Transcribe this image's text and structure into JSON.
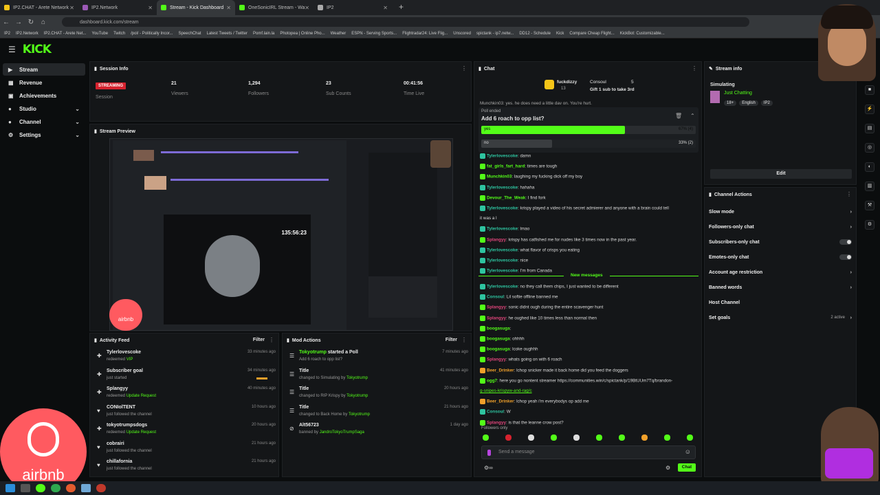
{
  "browser": {
    "tabs": [
      {
        "title": "IP2.CHAT - Arete Network",
        "color": "#f5c518"
      },
      {
        "title": "IP2.Network",
        "color": "#9b59b6"
      },
      {
        "title": "Stream - Kick Dashboard",
        "color": "#53fc18"
      },
      {
        "title": "OneSonicIRL Stream - Wa",
        "color": "#53fc18"
      },
      {
        "title": "IP2",
        "color": "#aaaaaa"
      }
    ],
    "url": "dashboard.kick.com/stream",
    "bookmarks": [
      "IP2",
      "IP2.Network",
      "IP2.CHAT - Arete Net...",
      "YouTube",
      "Twitch",
      "/pol/ - Politically Incor...",
      "SpeechChat",
      "Latest Tweets / Twitter",
      "Pomf.lain.la",
      "Photopea | Online Pho...",
      "Weather",
      "ESPN - Serving Sports...",
      "Flightradar24: Live Flig...",
      "Unscored",
      "spictank - ip7.netw...",
      "DD12 - Schedule",
      "Kick",
      "Compare Cheap Flight...",
      "KickBot: Customizable..."
    ]
  },
  "app": {
    "logo": "KICK",
    "accent": "#53fc18"
  },
  "sidebar": {
    "items": [
      {
        "label": "Stream",
        "icon": "play-icon"
      },
      {
        "label": "Revenue",
        "icon": "revenue-icon"
      },
      {
        "label": "Achievements",
        "icon": "trophy-icon"
      },
      {
        "label": "Studio",
        "icon": "studio-icon"
      },
      {
        "label": "Channel",
        "icon": "channel-icon"
      },
      {
        "label": "Settings",
        "icon": "gear-icon"
      }
    ]
  },
  "session": {
    "title": "Session Info",
    "status": "STREAMING",
    "session_label": "Session",
    "viewers": "21",
    "viewers_label": "Viewers",
    "followers": "1,294",
    "followers_label": "Followers",
    "subs": "23",
    "subs_label": "Sub Counts",
    "time": "00:41:56",
    "time_label": "Time Live"
  },
  "preview": {
    "title": "Stream Preview",
    "timer": "135:56:23",
    "sponsor": "airbnb"
  },
  "activity": {
    "title": "Activity Feed",
    "filter": "Filter",
    "rows": [
      {
        "icon": "sub-icon",
        "name": "Tylerlovescoke",
        "sub": "redeemed",
        "hl": "VIP",
        "time": "33 minutes ago"
      },
      {
        "icon": "goal-icon",
        "name": "Subscriber goal",
        "sub": "just started",
        "hl": "",
        "time": "34 minutes ago"
      },
      {
        "icon": "sub-icon",
        "name": "Splangyy",
        "sub": "redeemed",
        "hl": "Update Request",
        "time": "40 minutes ago"
      },
      {
        "icon": "heart-icon",
        "name": "CONIolTENT",
        "sub": "just followed the channel",
        "hl": "",
        "time": "10 hours ago"
      },
      {
        "icon": "sub-icon",
        "name": "tokyotrumpsdogs",
        "sub": "redeemed",
        "hl": "Update Request",
        "time": "20 hours ago"
      },
      {
        "icon": "heart-icon",
        "name": "cobrairi",
        "sub": "just followed the channel",
        "hl": "",
        "time": "21 hours ago"
      },
      {
        "icon": "heart-icon",
        "name": "chillafornia",
        "sub": "just followed the channel",
        "hl": "",
        "time": "21 hours ago"
      }
    ]
  },
  "mod": {
    "title": "Mod Actions",
    "filter": "Filter",
    "rows": [
      {
        "icon": "poll-icon",
        "name": "Tokyotrump",
        "name2": " started a Poll",
        "sub": "Add 6 roach to opp list?",
        "hl": "",
        "time": "7 minutes ago"
      },
      {
        "icon": "title-icon",
        "name": "Title",
        "name2": "",
        "sub": "changed to Simulating by ",
        "hl": "Tokyotrump",
        "time": "41 minutes ago"
      },
      {
        "icon": "title-icon",
        "name": "Title",
        "name2": "",
        "sub": "changed to RIP Krispy by ",
        "hl": "Tokyotrump",
        "time": "20 hours ago"
      },
      {
        "icon": "title-icon",
        "name": "Title",
        "name2": "",
        "sub": "changed to Back Home by ",
        "hl": "Tokyotrump",
        "time": "21 hours ago"
      },
      {
        "icon": "ban-icon",
        "name": "Alt56723",
        "name2": "",
        "sub": "banned by ",
        "hl": "JandroTokyoTrumpSaga",
        "time": "1 day ago"
      }
    ]
  },
  "chat": {
    "title": "Chat",
    "pinned": {
      "user": "fuckdizzy",
      "count": "13",
      "user2": "Consoul",
      "count2": "5",
      "text": "Gift 1 sub to take 3rd"
    },
    "poll": {
      "status": "Poll ended",
      "question": "Add 6 roach to opp list?",
      "opt1": "yes",
      "opt1_pct": "67% (4)",
      "opt1_frac": 0.67,
      "opt2": "no",
      "opt2_pct": "33% (2)",
      "opt2_frac": 0.33
    },
    "top": "Munchkin03: yes. he does need a little dav on. You're hurt.",
    "messages": [
      {
        "u": "Tylerlovescoke",
        "c": "#2ec4a0",
        "t": "damn"
      },
      {
        "u": "fat_girls_fart_hard",
        "c": "#53fc18",
        "t": "times are tough"
      },
      {
        "u": "Munchkin03",
        "c": "#53fc18",
        "t": "laughing my fucking dick off my boy"
      },
      {
        "u": "Tylerlovescoke",
        "c": "#2ec4a0",
        "t": "hahaha"
      },
      {
        "u": "Devour_The_Weak",
        "c": "#53fc18",
        "t": "I find fork"
      },
      {
        "u": "Tylerlovescoke",
        "c": "#2ec4a0",
        "t": "krispy played a video of his secret admierer and anyone with a brain could tell"
      },
      {
        "u": "",
        "c": "#ddd",
        "t": "it was a l"
      },
      {
        "u": "Tylerlovescoke",
        "c": "#2ec4a0",
        "t": "lmao"
      },
      {
        "u": "Splangyy",
        "c": "#e0457b",
        "t": "krispy has catfished me for nudes like 3 times now in the past year."
      },
      {
        "u": "Tylerlovescoke",
        "c": "#2ec4a0",
        "t": "what flavor of crisps you eating"
      },
      {
        "u": "Tylerlovescoke",
        "c": "#2ec4a0",
        "t": "nice"
      },
      {
        "u": "Tylerlovescoke",
        "c": "#2ec4a0",
        "t": "I'm from Canada"
      }
    ],
    "new_label": "New messages",
    "messages2": [
      {
        "u": "Tylerlovescoke",
        "c": "#2ec4a0",
        "t": "no they call them chips, I just wanted to be different"
      },
      {
        "u": "Consoul",
        "c": "#2ec4a0",
        "t": "Lil softie offline banned me"
      },
      {
        "u": "Splangyy",
        "c": "#e0457b",
        "t": "sonic didnt ough during the entire scavenger hunt"
      },
      {
        "u": "Splangyy",
        "c": "#e0457b",
        "t": "he oughed like 10 times less than normal then"
      },
      {
        "u": "boogasuga",
        "c": "#53fc18",
        "t": ""
      },
      {
        "u": "boogasuga",
        "c": "#53fc18",
        "t": "ohhhh"
      },
      {
        "u": "boogasuga",
        "c": "#53fc18",
        "t": "lcoke oughhh"
      },
      {
        "u": "Splangyy",
        "c": "#e0457b",
        "t": "whats going on with 6 roach"
      },
      {
        "u": "Beer_Drinker",
        "c": "#f0a02a",
        "t": "lchop snicker made it back home did you feed the doggers"
      },
      {
        "u": "ogg7",
        "c": "#53fc18",
        "t": "here you go nontent streamer https://communities.win/c/spictank/p/19BtUUm7Tq/brandon-"
      },
      {
        "u": "",
        "c": "#53fc18",
        "t": "g-snipes-krispyw-and-rag/c"
      },
      {
        "u": "Beer_Drinker",
        "c": "#f0a02a",
        "t": "lchop yeah i'm everybodys op add me"
      },
      {
        "u": "Consoul",
        "c": "#2ec4a0",
        "t": "W"
      },
      {
        "u": "Splangyy",
        "c": "#e0457b",
        "t": "is that the leanne crow post?"
      }
    ],
    "followers_only": "Followers only",
    "placeholder": "Send a message",
    "send": "Chat"
  },
  "streaminfo": {
    "title": "Stream info",
    "stream_title": "Simulating",
    "category": "Just Chatting",
    "tags": [
      "18+",
      "English",
      "IP2"
    ],
    "edit": "Edit"
  },
  "channel_actions": {
    "title": "Channel Actions",
    "rows": [
      {
        "label": "Slow mode",
        "type": "chev"
      },
      {
        "label": "Followers-only chat",
        "type": "chev"
      },
      {
        "label": "Subscribers-only chat",
        "type": "toggle"
      },
      {
        "label": "Emotes-only chat",
        "type": "toggle"
      },
      {
        "label": "Account age restriction",
        "type": "chev"
      },
      {
        "label": "Banned words",
        "type": "chev"
      },
      {
        "label": "Host Channel",
        "type": "none"
      },
      {
        "label": "Set goals",
        "type": "active"
      }
    ],
    "active_label": "2 active"
  }
}
